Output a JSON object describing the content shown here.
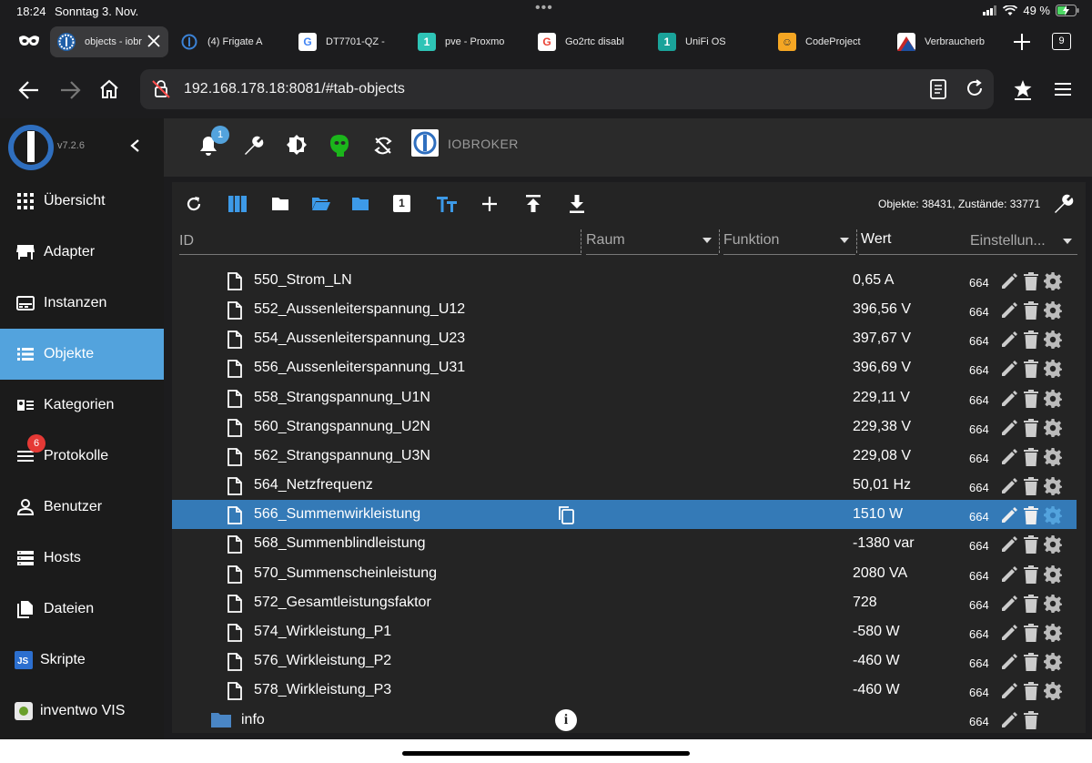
{
  "status": {
    "time": "18:24",
    "date": "Sonntag 3. Nov.",
    "battery": "49 %"
  },
  "browser": {
    "tabs": [
      {
        "label": "objects - iobr",
        "active": true
      },
      {
        "label": "(4) Frigate A"
      },
      {
        "label": "DT7701-QZ -"
      },
      {
        "label": "pve - Proxmo"
      },
      {
        "label": "Go2rtc disabl"
      },
      {
        "label": "UniFi OS"
      },
      {
        "label": "CodeProject"
      },
      {
        "label": "Verbraucherb"
      }
    ],
    "tab_count": "9",
    "url": "192.168.178.18:8081/#tab-objects"
  },
  "app": {
    "version": "v7.2.6",
    "brand": "IOBROKER",
    "notifications_badge": "1"
  },
  "sidebar": {
    "items": [
      {
        "label": "Übersicht",
        "icon": "grid-icon"
      },
      {
        "label": "Adapter",
        "icon": "store-icon"
      },
      {
        "label": "Instanzen",
        "icon": "instances-icon"
      },
      {
        "label": "Objekte",
        "icon": "list-icon",
        "active": true
      },
      {
        "label": "Kategorien",
        "icon": "categories-icon"
      },
      {
        "label": "Protokolle",
        "icon": "log-icon",
        "badge": "6"
      },
      {
        "label": "Benutzer",
        "icon": "user-icon"
      },
      {
        "label": "Hosts",
        "icon": "hosts-icon"
      },
      {
        "label": "Dateien",
        "icon": "files-icon"
      },
      {
        "label": "Skripte",
        "icon": "js-icon"
      },
      {
        "label": "inventwo VIS",
        "icon": "vis-icon"
      }
    ]
  },
  "objects": {
    "summary": "Objekte: 38431, Zustände: 33771",
    "toolbar_badge": "1",
    "columns": {
      "id": "ID",
      "room": "Raum",
      "function": "Funktion",
      "value": "Wert",
      "settings": "Einstellun..."
    },
    "rows": [
      {
        "name": "550_Strom_LN",
        "value": "0,65 A",
        "perm": "664"
      },
      {
        "name": "552_Aussenleiterspannung_U12",
        "value": "396,56 V",
        "perm": "664"
      },
      {
        "name": "554_Aussenleiterspannung_U23",
        "value": "397,67 V",
        "perm": "664"
      },
      {
        "name": "556_Aussenleiterspannung_U31",
        "value": "396,69 V",
        "perm": "664"
      },
      {
        "name": "558_Strangspannung_U1N",
        "value": "229,11 V",
        "perm": "664"
      },
      {
        "name": "560_Strangspannung_U2N",
        "value": "229,38 V",
        "perm": "664"
      },
      {
        "name": "562_Strangspannung_U3N",
        "value": "229,08 V",
        "perm": "664"
      },
      {
        "name": "564_Netzfrequenz",
        "value": "50,01 Hz",
        "perm": "664"
      },
      {
        "name": "566_Summenwirkleistung",
        "value": "1510 W",
        "perm": "664",
        "selected": true
      },
      {
        "name": "568_Summenblindleistung",
        "value": "-1380 var",
        "perm": "664"
      },
      {
        "name": "570_Summenscheinleistung",
        "value": "2080 VA",
        "perm": "664"
      },
      {
        "name": "572_Gesamtleistungsfaktor",
        "value": "728",
        "perm": "664"
      },
      {
        "name": "574_Wirkleistung_P1",
        "value": "-580 W",
        "perm": "664"
      },
      {
        "name": "576_Wirkleistung_P2",
        "value": "-460 W",
        "perm": "664"
      },
      {
        "name": "578_Wirkleistung_P3",
        "value": "-460 W",
        "perm": "664"
      }
    ],
    "folder": {
      "name": "info",
      "perm": "664"
    }
  },
  "colors": {
    "accent": "#53a3dd",
    "selected_row": "#347ab7",
    "badge_red": "#e53935",
    "toolbar_blue": "#3d9ae8",
    "mask_green": "#1bb51b"
  }
}
